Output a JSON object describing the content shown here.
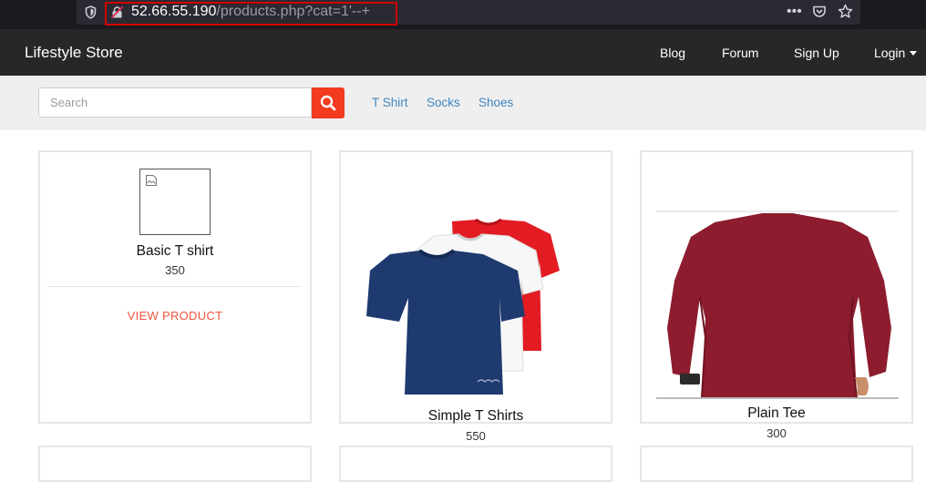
{
  "browser": {
    "url_host": "52.66.55.190",
    "url_path": "/products.php?cat=1'--+",
    "icons": [
      "shield-icon",
      "lock-warning-icon",
      "more-icon",
      "pocket-icon",
      "star-icon"
    ]
  },
  "navbar": {
    "brand": "Lifestyle Store",
    "links": [
      "Blog",
      "Forum",
      "Sign Up",
      "Login"
    ]
  },
  "search": {
    "placeholder": "Search",
    "button_icon": "search-icon",
    "button_color": "#f23b1f"
  },
  "categories": [
    "T Shirt",
    "Socks",
    "Shoes"
  ],
  "products": [
    {
      "name": "Basic T shirt",
      "price": "350",
      "action": "VIEW PRODUCT",
      "image": "broken-image-icon"
    },
    {
      "name": "Simple T Shirts",
      "price": "550",
      "image": "tshirts-stack-image"
    },
    {
      "name": "Plain Tee",
      "price": "300",
      "image": "maroon-longsleeve-image"
    }
  ],
  "colors": {
    "navbar_bg": "#272727",
    "subbar_bg": "#efefef",
    "link": "#3f86c0",
    "accent": "#f0553e",
    "highlight_box": "#d10000"
  }
}
